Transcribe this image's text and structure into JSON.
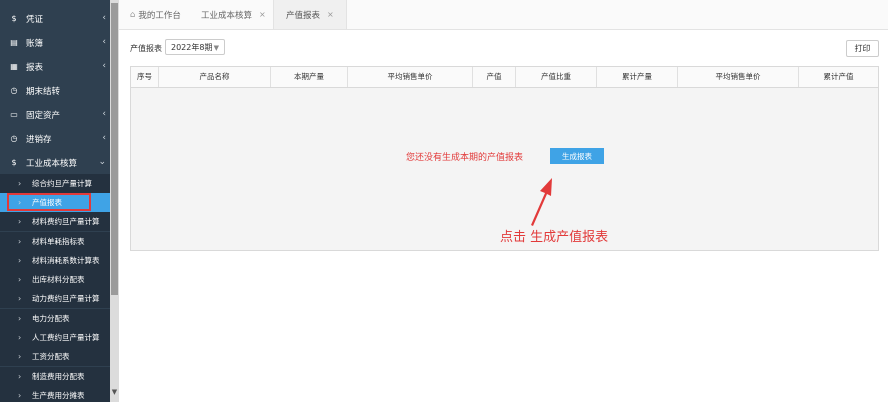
{
  "sidebar": {
    "items": [
      {
        "icon": "$",
        "icon_name": "dollar-icon",
        "label": "凭证",
        "chevron": "‹"
      },
      {
        "icon": "▤",
        "icon_name": "ledger-icon",
        "label": "账簿",
        "chevron": "‹"
      },
      {
        "icon": "▦",
        "icon_name": "report-icon",
        "label": "报表",
        "chevron": "‹"
      },
      {
        "icon": "◷",
        "icon_name": "period-close-icon",
        "label": "期末结转",
        "chevron": ""
      },
      {
        "icon": "▭",
        "icon_name": "monitor-icon",
        "label": "固定资产",
        "chevron": "‹"
      },
      {
        "icon": "◷",
        "icon_name": "inventory-icon",
        "label": "进销存",
        "chevron": "‹"
      },
      {
        "icon": "$",
        "icon_name": "dollar-icon",
        "label": "工业成本核算",
        "chevron": "⌄"
      }
    ],
    "subitems": [
      {
        "label": "综合约旦产量计算",
        "active": false
      },
      {
        "label": "产值报表",
        "active": true
      },
      {
        "label": "材料费约旦产量计算",
        "active": false
      },
      {
        "label": "材料单耗指标表",
        "active": false
      },
      {
        "label": "材料消耗系数计算表",
        "active": false
      },
      {
        "label": "出库材料分配表",
        "active": false
      },
      {
        "label": "动力费约旦产量计算",
        "active": false
      },
      {
        "label": "电力分配表",
        "active": false
      },
      {
        "label": "人工费约旦产量计算",
        "active": false
      },
      {
        "label": "工资分配表",
        "active": false
      },
      {
        "label": "制造费用分配表",
        "active": false
      },
      {
        "label": "生产费用分摊表",
        "active": false
      }
    ],
    "subitem_arrow": "›"
  },
  "tabs": [
    {
      "label": "我的工作台",
      "closable": false,
      "icon": "⌂"
    },
    {
      "label": "工业成本核算",
      "closable": true
    },
    {
      "label": "产值报表",
      "closable": true
    }
  ],
  "tab_close": "×",
  "toolbar": {
    "report_label": "产值报表",
    "period_value": "2022年8期",
    "print_label": "打印"
  },
  "table": {
    "columns": [
      "序号",
      "产品名称",
      "本期产量",
      "平均销售单价",
      "产值",
      "产值比重",
      "累计产量",
      "平均销售单价",
      "累计产值"
    ]
  },
  "empty": {
    "message": "您还没有生成本期的产值报表",
    "generate_label": "生成报表"
  },
  "annotation": {
    "text": "点击 生成产值报表",
    "color": "#e23a3a"
  },
  "colors": {
    "sidebar_bg": "#2f4050",
    "accent": "#3fa3e6",
    "highlight": "#e23a3a"
  }
}
